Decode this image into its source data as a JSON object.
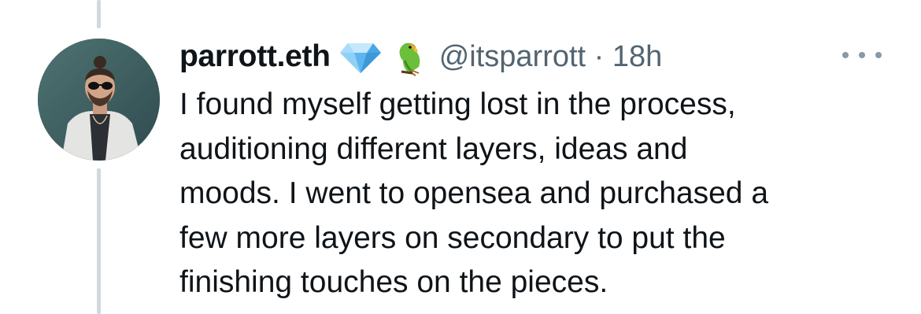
{
  "tweet": {
    "author_name": "parrott.eth",
    "badges": [
      "gem-stone-emoji",
      "parrot-emoji"
    ],
    "meta": "@itsparrott · 18h",
    "text_lines": [
      "I found myself getting lost in the process,",
      "auditioning different layers, ideas and",
      "moods. I went to opensea and purchased a",
      "few more layers on secondary to put the",
      "finishing touches on the pieces."
    ]
  },
  "colors": {
    "text_primary": "#0f1419",
    "text_secondary": "#536471",
    "thread_line": "#cfd9de"
  }
}
